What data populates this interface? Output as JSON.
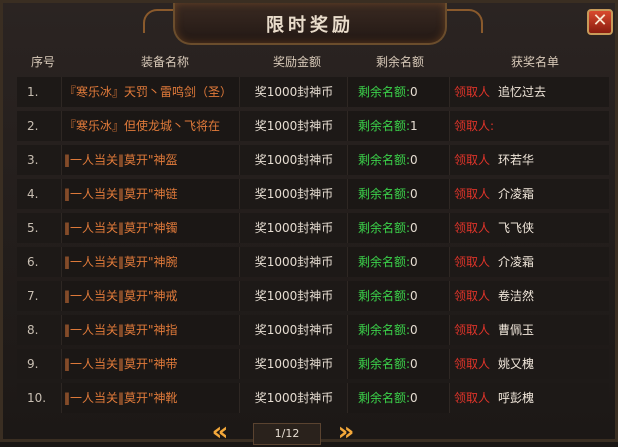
{
  "title": "限时奖励",
  "close_label": "✕",
  "headers": [
    "序号",
    "装备名称",
    "奖励金额",
    "剩余名额",
    "获奖名单"
  ],
  "rows": [
    {
      "no": "1.",
      "item": "『寒乐冰』天罚丶雷鸣剑（圣）",
      "reward": "奖1000封神币",
      "remain_label": "剩余名额:",
      "remain_value": "0",
      "winner_label": "领取人",
      "winner": "追忆过去"
    },
    {
      "no": "2.",
      "item": "『寒乐冰』但使龙城丶飞将在",
      "reward": "奖1000封神币",
      "remain_label": "剩余名额:",
      "remain_value": "1",
      "winner_label": "领取人:",
      "winner": ""
    },
    {
      "no": "3.",
      "item": "‖一人当关‖莫开\"神盔",
      "reward": "奖1000封神币",
      "remain_label": "剩余名额:",
      "remain_value": "0",
      "winner_label": "领取人",
      "winner": "环若华"
    },
    {
      "no": "4.",
      "item": "‖一人当关‖莫开\"神链",
      "reward": "奖1000封神币",
      "remain_label": "剩余名额:",
      "remain_value": "0",
      "winner_label": "领取人",
      "winner": "介凌霜"
    },
    {
      "no": "5.",
      "item": "‖一人当关‖莫开\"神镯",
      "reward": "奖1000封神币",
      "remain_label": "剩余名额:",
      "remain_value": "0",
      "winner_label": "领取人",
      "winner": "飞飞侠"
    },
    {
      "no": "6.",
      "item": "‖一人当关‖莫开\"神腕",
      "reward": "奖1000封神币",
      "remain_label": "剩余名额:",
      "remain_value": "0",
      "winner_label": "领取人",
      "winner": "介凌霜"
    },
    {
      "no": "7.",
      "item": "‖一人当关‖莫开\"神戒",
      "reward": "奖1000封神币",
      "remain_label": "剩余名额:",
      "remain_value": "0",
      "winner_label": "领取人",
      "winner": "卷洁然"
    },
    {
      "no": "8.",
      "item": "‖一人当关‖莫开\"神指",
      "reward": "奖1000封神币",
      "remain_label": "剩余名额:",
      "remain_value": "0",
      "winner_label": "领取人",
      "winner": "曹佩玉"
    },
    {
      "no": "9.",
      "item": "‖一人当关‖莫开\"神带",
      "reward": "奖1000封神币",
      "remain_label": "剩余名额:",
      "remain_value": "0",
      "winner_label": "领取人",
      "winner": "姚又槐"
    },
    {
      "no": "10.",
      "item": "‖一人当关‖莫开\"神靴",
      "reward": "奖1000封神币",
      "remain_label": "剩余名额:",
      "remain_value": "0",
      "winner_label": "领取人",
      "winner": "呼彭槐"
    }
  ],
  "pager": {
    "text": "1/12",
    "prev_icon": "«",
    "next_icon": "»"
  },
  "colors": {
    "item": "#e07a3a",
    "remain_label": "#3bd24a",
    "winner_label": "#e0342a",
    "accent": "#f4a83a"
  }
}
